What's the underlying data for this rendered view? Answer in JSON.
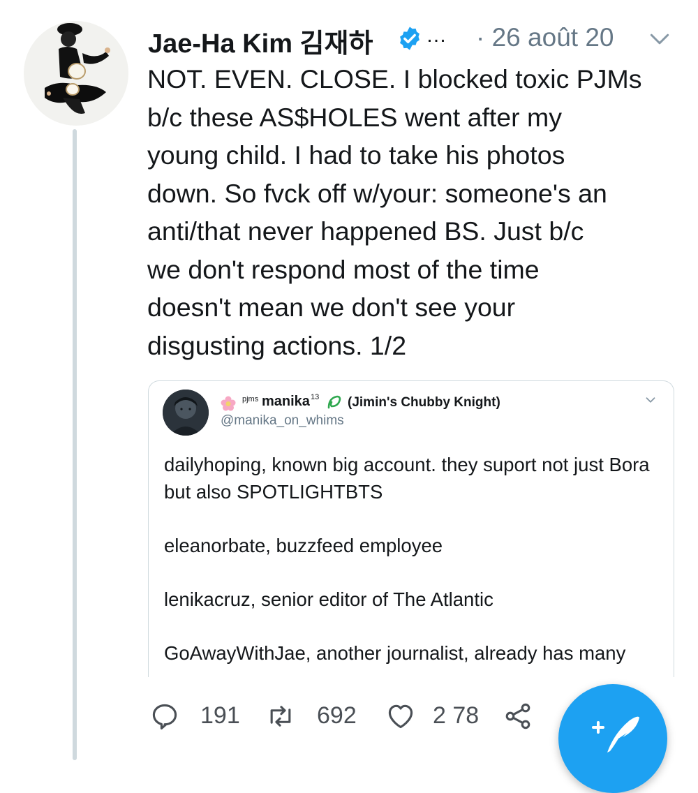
{
  "tweet": {
    "author_name": "Jae-Ha Kim 김재하",
    "ellipsis": "…",
    "timestamp": "· 26 août 20",
    "text": [
      "NOT. EVEN. CLOSE. I blocked toxic PJMs",
      "b/c these AS$HOLES went after my",
      "young child. I had to take his photos",
      "down. So fvck off w/your: someone's an",
      "anti/that never happened BS. Just b/c",
      "we don't respond most of the time",
      "doesn't mean we don't see your",
      "disgusting actions. 1/2"
    ]
  },
  "quote": {
    "name_prefix": "pjms",
    "name_main": "manika",
    "name_sup": "13",
    "name_tail": "(Jimin's Chubby Knight)",
    "handle": "@manika_on_whims",
    "paragraphs": [
      "dailyhoping, known big account. they suport not just Bora but also SPOTLIGHTBTS",
      "eleanorbate, buzzfeed employee",
      "lenikacruz, senior editor of The Atlantic",
      "GoAwayWithJae, another journalist, already has many"
    ]
  },
  "actions": {
    "replies": "191",
    "retweets": "692",
    "likes": "2 78"
  },
  "colors": {
    "brand_blue": "#1da1f2",
    "muted": "#657786",
    "line": "#cfd9de"
  },
  "icons": [
    "verified-badge-icon",
    "chevron-down-icon",
    "reply-icon",
    "retweet-icon",
    "heart-icon",
    "share-icon",
    "compose-icon",
    "flower-icon",
    "leaf-icon"
  ]
}
